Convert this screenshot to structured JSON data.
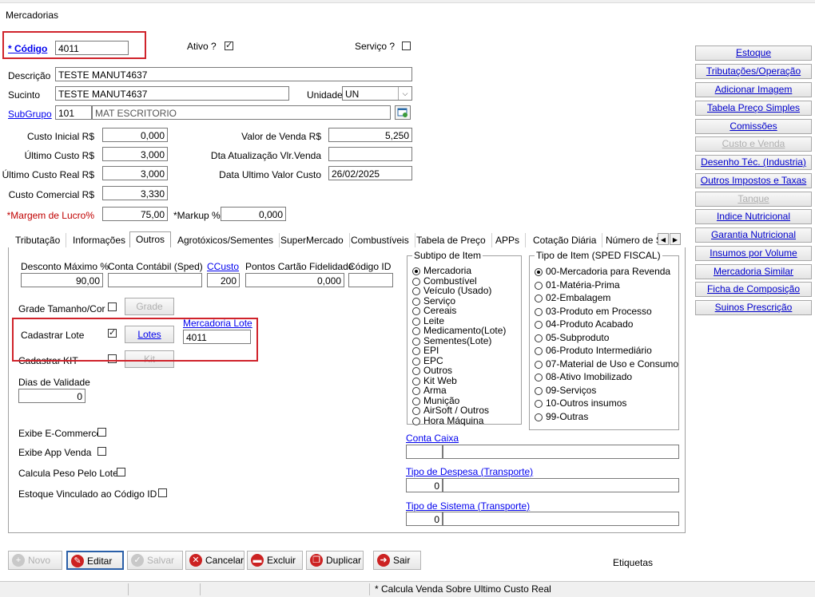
{
  "window": {
    "title": "Mercadorias"
  },
  "form": {
    "codigo_label": "* Código",
    "codigo_value": "4011",
    "ativo_label": "Ativo ?",
    "servico_label": "Serviço ?",
    "descricao_label": "Descrição",
    "descricao_value": "TESTE MANUT4637",
    "sucinto_label": "Sucinto",
    "sucinto_value": "TESTE MANUT4637",
    "unidade_label": "Unidade",
    "unidade_value": "UN",
    "subgrupo_label": "SubGrupo",
    "subgrupo_code": "101",
    "subgrupo_name": "MAT ESCRITORIO",
    "custo_inicial_label": "Custo Inicial R$",
    "custo_inicial_value": "0,000",
    "ultimo_custo_label": "Último Custo R$",
    "ultimo_custo_value": "3,000",
    "ultimo_custo_real_label": "Último Custo Real R$",
    "ultimo_custo_real_value": "3,000",
    "custo_comercial_label": "Custo Comercial R$",
    "custo_comercial_value": "3,330",
    "margem_label": "*Margem de Lucro%",
    "margem_value": "75,00",
    "markup_label": "*Markup %",
    "markup_value": "0,000",
    "valor_venda_label": "Valor de Venda R$",
    "valor_venda_value": "5,250",
    "dta_atualizacao_label": "Dta Atualização Vlr.Venda",
    "dta_atualizacao_value": "",
    "data_ultimo_label": "Data Ultimo Valor Custo",
    "data_ultimo_value": "26/02/2025"
  },
  "sidebar": {
    "items": [
      {
        "label": "Estoque",
        "enabled": true
      },
      {
        "label": "Tributações/Operação",
        "enabled": true
      },
      {
        "label": "Adicionar Imagem",
        "enabled": true
      },
      {
        "label": "Tabela Preço Simples",
        "enabled": true
      },
      {
        "label": "Comissões",
        "enabled": true
      },
      {
        "label": "Custo e Venda",
        "enabled": false
      },
      {
        "label": "Desenho Téc. (Industria)",
        "enabled": true
      },
      {
        "label": "Outros Impostos e Taxas",
        "enabled": true
      },
      {
        "label": "Tanque",
        "enabled": false
      },
      {
        "label": "Indice Nutricional",
        "enabled": true
      },
      {
        "label": "Garantia Nutricional",
        "enabled": true
      },
      {
        "label": "Insumos por Volume",
        "enabled": true
      },
      {
        "label": "Mercadoria Similar",
        "enabled": true
      },
      {
        "label": "Ficha de Composição",
        "enabled": true
      },
      {
        "label": "Suinos Prescrição",
        "enabled": true
      }
    ]
  },
  "tabs": [
    "Tributação",
    "Informações",
    "Outros",
    "Agrotóxicos/Sementes",
    "SuperMercado",
    "Combustíveis",
    "Tabela de Preço",
    "APPs",
    "Cotação Diária",
    "Número de S"
  ],
  "active_tab": "Outros",
  "outros": {
    "desconto_label": "Desconto Máximo %",
    "desconto_value": "90,00",
    "conta_contabil_label": "Conta Contábil (Sped)",
    "conta_contabil_value": "",
    "ccusto_label": "CCusto",
    "ccusto_value": "200",
    "pontos_label": "Pontos Cartão Fidelidade",
    "pontos_value": "0,000",
    "codigo_id_label": "Código ID",
    "codigo_id_value": "",
    "grade_label": "Grade Tamanho/Cor",
    "grade_button": "Grade",
    "lote_label": "Cadastrar Lote",
    "lotes_button": "Lotes",
    "mercadoria_lote_label": "Mercadoria Lote",
    "mercadoria_lote_value": "4011",
    "kit_label": "Cadastrar KIT",
    "kit_button": "Kit",
    "dias_validade_label": "Dias de Validade",
    "dias_validade_value": "0",
    "ecommerce_label": "Exibe E-Commerce",
    "app_venda_label": "Exibe App Venda",
    "peso_lote_label": "Calcula Peso Pelo Lote",
    "estoque_vinculado_label": "Estoque Vinculado ao Código ID ?",
    "subtipo_title": "Subtipo de Item",
    "subtipo_options": [
      "Mercadoria",
      "Combustível",
      "Veículo (Usado)",
      "Serviço",
      "Cereais",
      "Leite",
      "Medicamento(Lote)",
      "Sementes(Lote)",
      "EPI",
      "EPC",
      "Outros",
      "Kit Web",
      "Arma",
      "Munição",
      "AirSoft / Outros",
      "Hora Máquina"
    ],
    "tipo_title": "Tipo de Item (SPED FISCAL)",
    "tipo_options": [
      "00-Mercadoria para Revenda",
      "01-Matéria-Prima",
      "02-Embalagem",
      "03-Produto em Processo",
      "04-Produto Acabado",
      "05-Subproduto",
      "06-Produto Intermediário",
      "07-Material de Uso e Consumo",
      "08-Ativo Imobilizado",
      "09-Serviços",
      "10-Outros insumos",
      "99-Outras"
    ],
    "conta_caixa_label": "Conta Caixa",
    "conta_caixa_value": "",
    "tipo_despesa_label": "Tipo de Despesa (Transporte)",
    "tipo_despesa_value": "0",
    "tipo_sistema_label": "Tipo de Sistema (Transporte)",
    "tipo_sistema_value": "0"
  },
  "toolbar": {
    "novo": "Novo",
    "editar": "Editar",
    "salvar": "Salvar",
    "cancelar": "Cancelar",
    "excluir": "Excluir",
    "duplicar": "Duplicar",
    "sair": "Sair",
    "etiquetas": "Etiquetas"
  },
  "status": {
    "message": "* Calcula Venda Sobre Ultimo Custo  Real"
  }
}
